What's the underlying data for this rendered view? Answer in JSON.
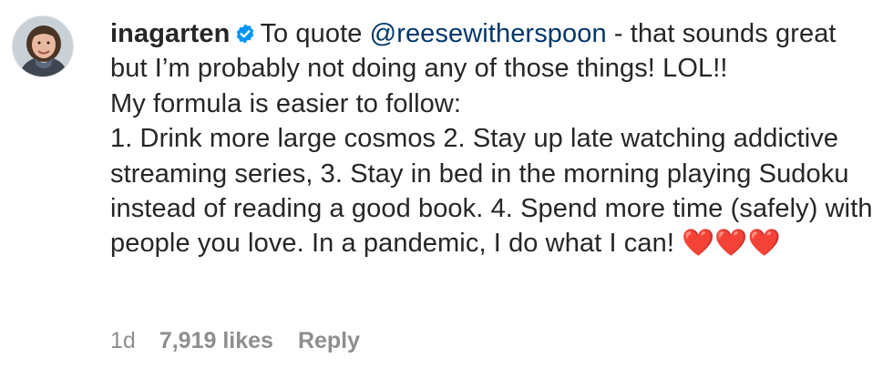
{
  "comment": {
    "username": "inagarten",
    "verified": true,
    "text_prefix": "To quote ",
    "mention": "@reesewitherspoon",
    "text_body": " - that sounds great but I’m probably not doing any of those things! LOL!!",
    "line_intro": "My formula is easier to follow:",
    "line_list": "1. Drink more large cosmos 2. Stay up late watching addictive streaming series, 3. Stay in bed in the morning playing Sudoku instead of reading a good book. 4. Spend more time (safely) with people you love. In a pandemic, I do what I can! ❤️❤️❤️",
    "time": "1d",
    "likes": "7,919 likes",
    "reply_label": "Reply"
  },
  "colors": {
    "text": "#262626",
    "mention": "#00376b",
    "meta": "#8e8e8e",
    "verified_badge": "#0095f6"
  },
  "icons": {
    "verified": "verified-badge-icon",
    "avatar": "profile-photo"
  }
}
